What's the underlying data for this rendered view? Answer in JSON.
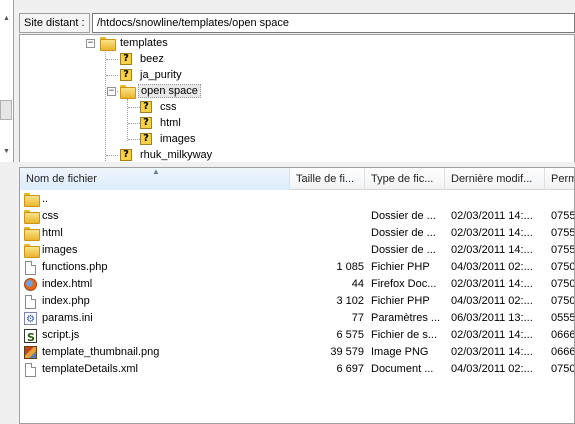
{
  "remote_path": {
    "label": "Site distant :",
    "value": "/htdocs/snowline/templates/open space"
  },
  "tree": {
    "items": [
      {
        "label": "templates",
        "icon": "folder-icon",
        "expander": "⊟"
      },
      {
        "label": "beez",
        "icon": "unknown-folder-icon"
      },
      {
        "label": "ja_purity",
        "icon": "unknown-folder-icon"
      },
      {
        "label": "open space",
        "icon": "folder-icon",
        "expander": "⊟",
        "selected": true
      },
      {
        "label": "css",
        "icon": "unknown-folder-icon"
      },
      {
        "label": "html",
        "icon": "unknown-folder-icon"
      },
      {
        "label": "images",
        "icon": "unknown-folder-icon"
      },
      {
        "label": "rhuk_milkyway",
        "icon": "unknown-folder-icon"
      }
    ]
  },
  "filelist": {
    "columns": {
      "name": "Nom de fichier",
      "size": "Taille de fi...",
      "type": "Type de fic...",
      "date": "Dernière modif...",
      "perm": "Perm"
    },
    "sort_indicator": "▲",
    "rows": [
      {
        "name": "..",
        "size": "",
        "type": "",
        "date": "",
        "perm": "",
        "icon": "folder-icon"
      },
      {
        "name": "css",
        "size": "",
        "type": "Dossier de ...",
        "date": "02/03/2011 14:...",
        "perm": "0755",
        "icon": "folder-icon"
      },
      {
        "name": "html",
        "size": "",
        "type": "Dossier de ...",
        "date": "02/03/2011 14:...",
        "perm": "0755",
        "icon": "folder-icon"
      },
      {
        "name": "images",
        "size": "",
        "type": "Dossier de ...",
        "date": "02/03/2011 14:...",
        "perm": "0755",
        "icon": "folder-icon"
      },
      {
        "name": "functions.php",
        "size": "1 085",
        "type": "Fichier PHP",
        "date": "04/03/2011 02:...",
        "perm": "0750",
        "icon": "file-icon"
      },
      {
        "name": "index.html",
        "size": "44",
        "type": "Firefox Doc...",
        "date": "02/03/2011 14:...",
        "perm": "0750",
        "icon": "firefox-icon"
      },
      {
        "name": "index.php",
        "size": "3 102",
        "type": "Fichier PHP",
        "date": "04/03/2011 02:...",
        "perm": "0750",
        "icon": "file-icon"
      },
      {
        "name": "params.ini",
        "size": "77",
        "type": "Paramètres ...",
        "date": "06/03/2011 13:...",
        "perm": "0555",
        "icon": "settings-file-icon"
      },
      {
        "name": "script.js",
        "size": "6 575",
        "type": "Fichier de s...",
        "date": "02/03/2011 14:...",
        "perm": "0666",
        "icon": "script-icon"
      },
      {
        "name": "template_thumbnail.png",
        "size": "39 579",
        "type": "Image PNG",
        "date": "02/03/2011 14:...",
        "perm": "0666",
        "icon": "image-icon"
      },
      {
        "name": "templateDetails.xml",
        "size": "6 697",
        "type": "Document ...",
        "date": "04/03/2011 02:...",
        "perm": "0750",
        "icon": "file-icon"
      }
    ]
  }
}
